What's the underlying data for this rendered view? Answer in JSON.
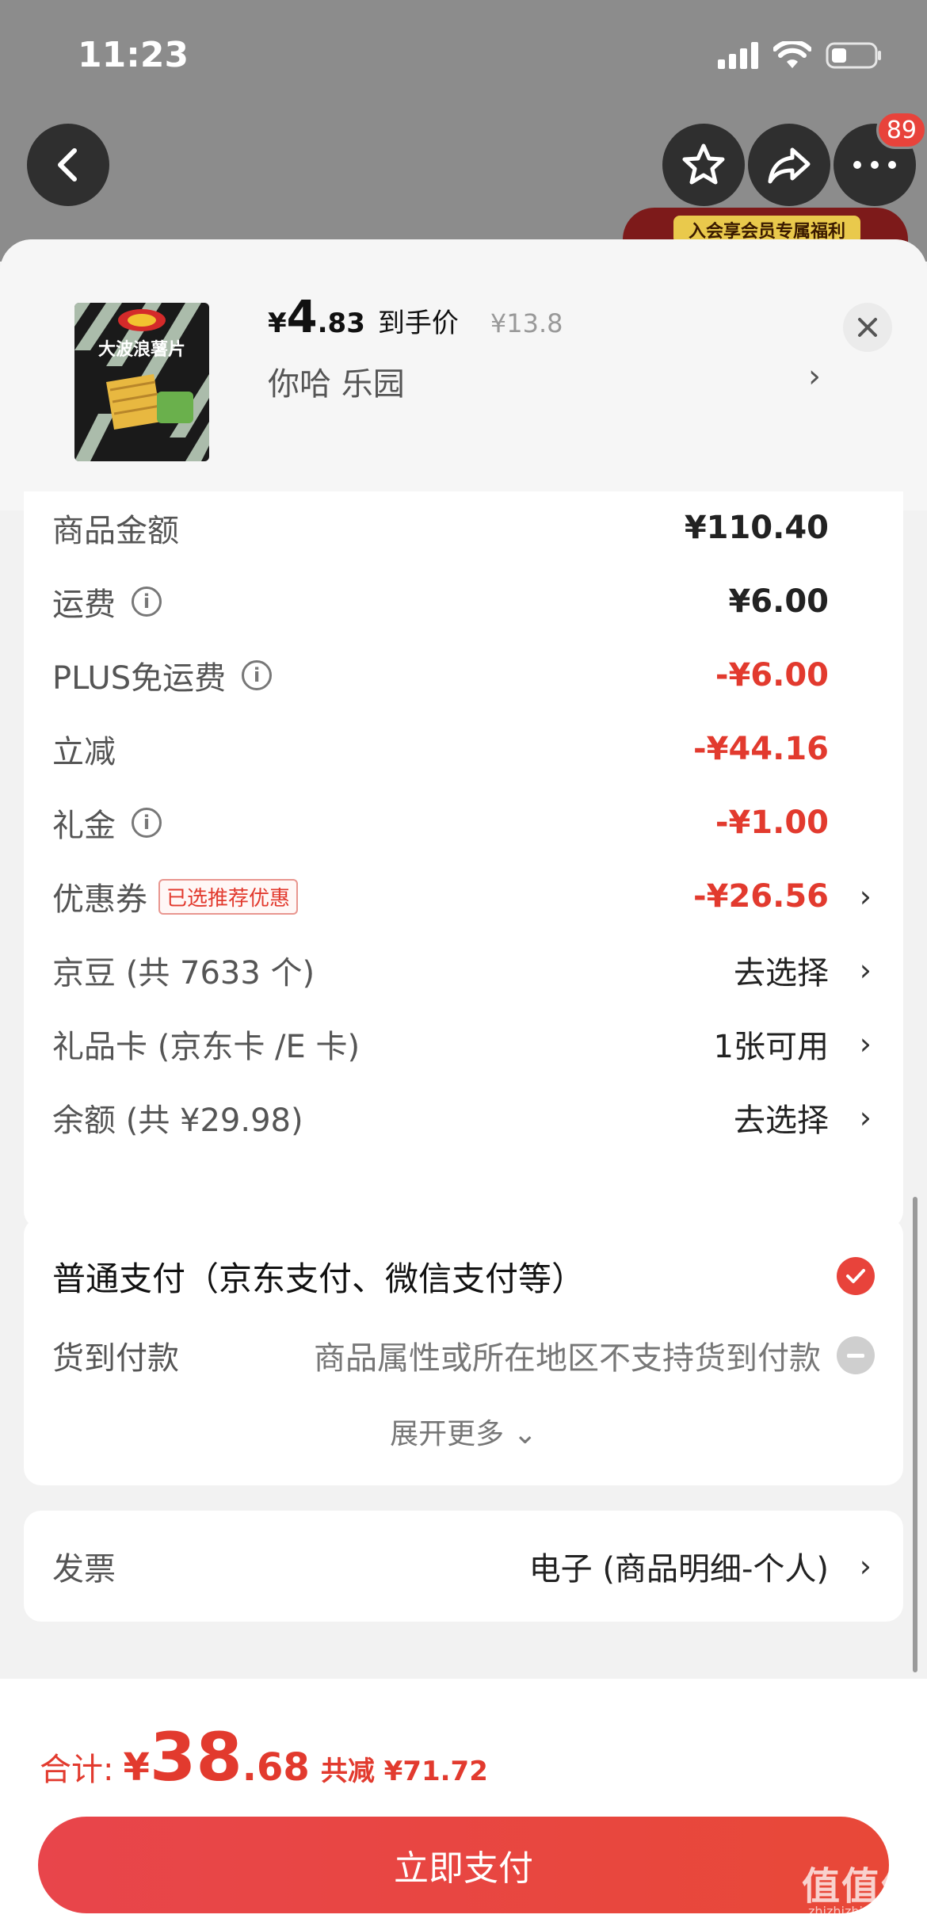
{
  "status_bar": {
    "time": "11:23"
  },
  "top_nav": {
    "badge_count": "89",
    "promo_text": "入会享会员专属福利"
  },
  "product": {
    "price_symbol": "¥",
    "price_int": "4",
    "price_dec": ".83",
    "price_tag": "到手价",
    "original_price": "¥13.8",
    "variant": "你哈  乐园",
    "brand_image_text": "大波浪薯片"
  },
  "summary": {
    "rows": [
      {
        "label": "商品金额",
        "value": "¥110.40"
      },
      {
        "label": "运费",
        "value": "¥6.00"
      },
      {
        "label": "PLUS免运费",
        "value": "-¥6.00"
      },
      {
        "label": "立减",
        "value": "-¥44.16"
      },
      {
        "label": "礼金",
        "value": "-¥1.00"
      },
      {
        "label": "优惠券",
        "tag": "已选推荐优惠",
        "value": "-¥26.56"
      },
      {
        "label": "京豆 (共 7633 个)",
        "value": "去选择"
      },
      {
        "label": "礼品卡 (京东卡 /E 卡)",
        "value": "1张可用"
      },
      {
        "label": "余额 (共 ¥29.98)",
        "value": "去选择"
      }
    ]
  },
  "payment": {
    "normal": "普通支付（京东支付、微信支付等）",
    "cod_label": "货到付款",
    "cod_note": "商品属性或所在地区不支持货到付款",
    "expand": "展开更多"
  },
  "invoice": {
    "label": "发票",
    "value": "电子 (商品明细-个人)"
  },
  "footer": {
    "total_label": "合计:",
    "total_symbol": "¥",
    "total_int": "38",
    "total_dec": ".68",
    "saved": "共减 ¥71.72",
    "pay_button": "立即支付"
  },
  "watermark": {
    "main": "值值值",
    "sub": "zhizhizhi.com"
  },
  "colors": {
    "accent_red": "#e23a2e",
    "button_red": "#e8454b"
  }
}
